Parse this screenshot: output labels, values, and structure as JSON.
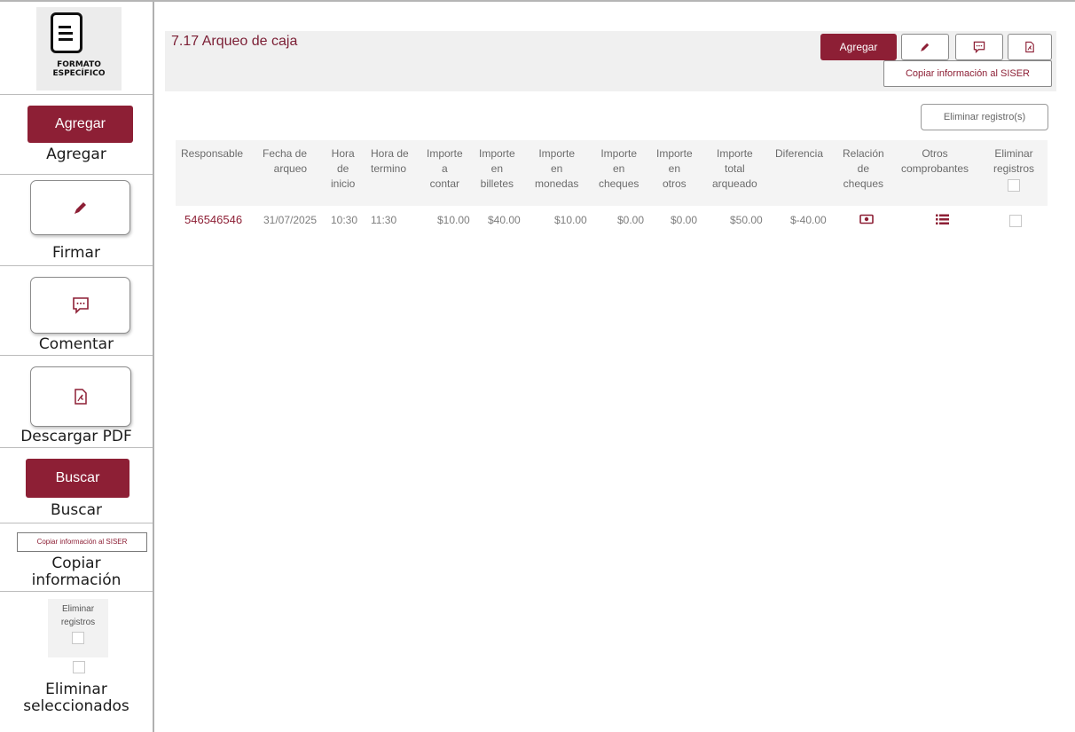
{
  "sidebar": {
    "logo_line1": "FORMATO",
    "logo_line2": "ESPECÍFICO",
    "agregar_button": "Agregar",
    "agregar_label": "Agregar",
    "firmar_label": "Firmar",
    "comentar_label": "Comentar",
    "pdf_label": "Descargar PDF",
    "buscar_button": "Buscar",
    "buscar_label": "Buscar",
    "copy_button": "Copiar información al SISER",
    "copy_label_1": "Copiar",
    "copy_label_2": "información",
    "elim_head_1": "Eliminar",
    "elim_head_2": "registros",
    "elim_label_1": "Eliminar",
    "elim_label_2": "seleccionados"
  },
  "header": {
    "title": "7.17 Arqueo de caja",
    "agregar": "Agregar",
    "copy": "Copiar información al SISER"
  },
  "eliminar_registros_button": "Eliminar registro(s)",
  "table": {
    "columns": [
      [
        "Responsable"
      ],
      [
        "Fecha de",
        "arqueo"
      ],
      [
        "Hora",
        "de",
        "inicio"
      ],
      [
        "Hora de",
        "termino"
      ],
      [
        "Importe",
        "a",
        "contar"
      ],
      [
        "Importe",
        "en",
        "billetes"
      ],
      [
        "Importe",
        "en",
        "monedas"
      ],
      [
        "Importe",
        "en",
        "cheques"
      ],
      [
        "Importe",
        "en",
        "otros"
      ],
      [
        "Importe",
        "total",
        "arqueado"
      ],
      [
        "Diferencia"
      ],
      [
        "Relación",
        "de",
        "cheques"
      ],
      [
        "Otros",
        "comprobantes"
      ],
      [
        "Eliminar",
        "registros"
      ]
    ],
    "row": {
      "responsable": "546546546",
      "fecha": "31/07/2025",
      "hora_inicio": "10:30",
      "hora_termino": "11:30",
      "importe_contar": "$10.00",
      "billetes": "$40.00",
      "monedas": "$10.00",
      "cheques": "$0.00",
      "otros": "$0.00",
      "total": "$50.00",
      "diferencia": "$-40.00"
    }
  },
  "colors": {
    "brand": "#8d1f35"
  }
}
